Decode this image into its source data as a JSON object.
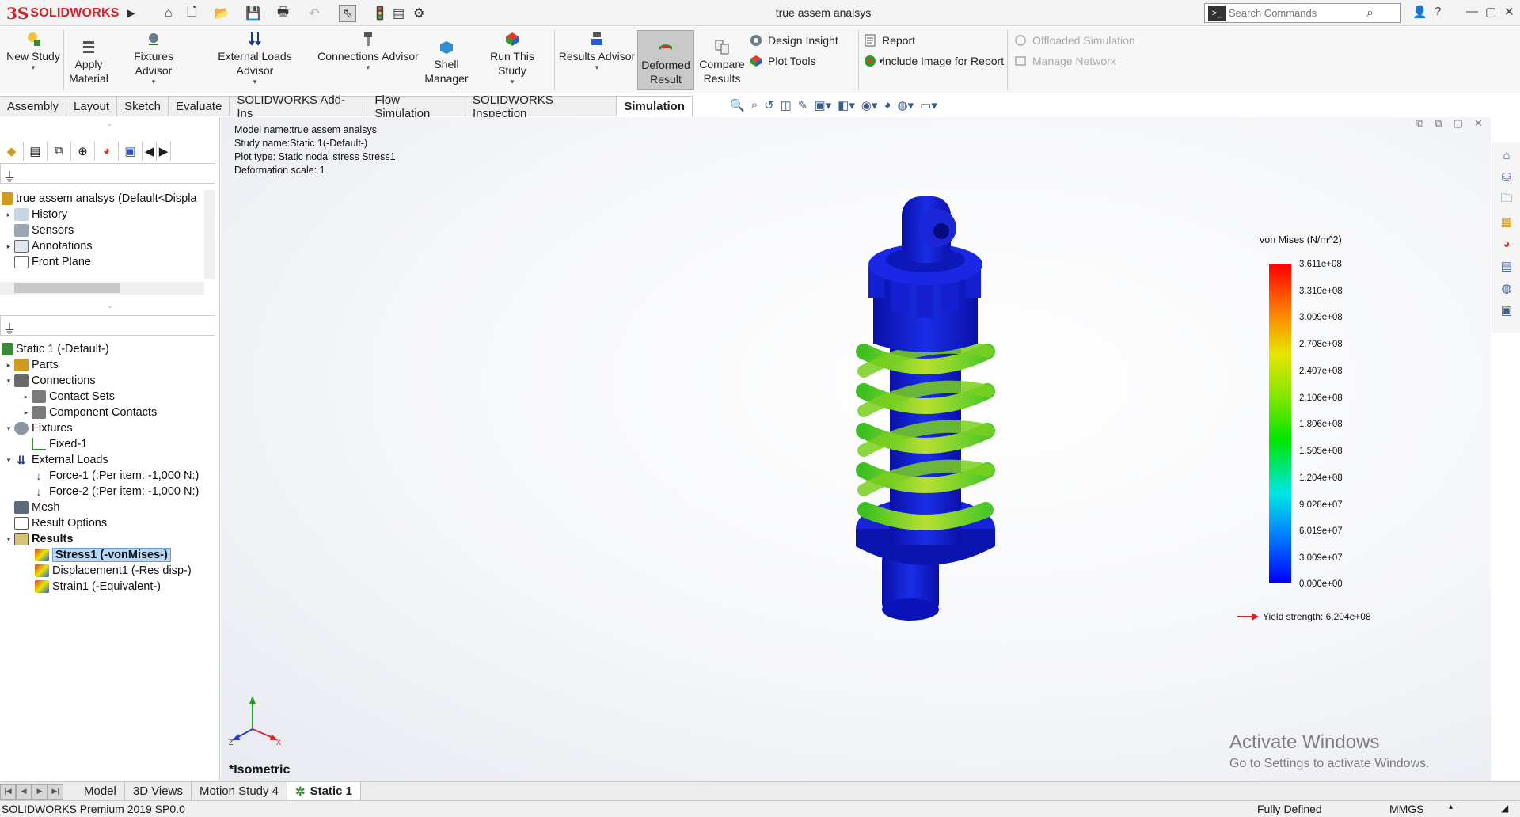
{
  "titlebar": {
    "logo_text": "SOLIDWORKS",
    "logo_mark": "3S",
    "window_title": "true assem analsys",
    "search_placeholder": "Search Commands"
  },
  "ribbon": {
    "buttons": [
      {
        "label": "New Study",
        "icon": "new-study-icon"
      },
      {
        "label": "Apply\nMaterial",
        "icon": "apply-material-icon"
      },
      {
        "label": "Fixtures Advisor",
        "icon": "fixtures-advisor-icon"
      },
      {
        "label": "External Loads Advisor",
        "icon": "external-loads-icon"
      },
      {
        "label": "Connections Advisor",
        "icon": "connections-advisor-icon"
      },
      {
        "label": "Shell\nManager",
        "icon": "shell-manager-icon"
      },
      {
        "label": "Run This Study",
        "icon": "run-study-icon"
      },
      {
        "label": "Results Advisor",
        "icon": "results-advisor-icon"
      },
      {
        "label": "Deformed\nResult",
        "icon": "deformed-result-icon",
        "active": true
      },
      {
        "label": "Compare\nResults",
        "icon": "compare-results-icon"
      }
    ],
    "small": {
      "design_insight": "Design Insight",
      "plot_tools": "Plot Tools",
      "report": "Report",
      "include_image": "Include Image for Report",
      "offloaded_simulation": "Offloaded Simulation",
      "manage_network": "Manage Network"
    }
  },
  "command_tabs": [
    "Assembly",
    "Layout",
    "Sketch",
    "Evaluate",
    "SOLIDWORKS Add-Ins",
    "Flow Simulation",
    "SOLIDWORKS Inspection",
    "Simulation"
  ],
  "active_command_tab": "Simulation",
  "feature_tree": {
    "root": "true assem analsys  (Default<Displa",
    "items": [
      "History",
      "Sensors",
      "Annotations",
      "Front Plane"
    ]
  },
  "study_tree": {
    "root": "Static 1 (-Default-)",
    "parts": "Parts",
    "connections": "Connections",
    "contact_sets": "Contact Sets",
    "component_contacts": "Component Contacts",
    "fixtures": "Fixtures",
    "fixed1": "Fixed-1",
    "external_loads": "External Loads",
    "force1": "Force-1 (:Per item: -1,000 N:)",
    "force2": "Force-2 (:Per item: -1,000 N:)",
    "mesh": "Mesh",
    "result_options": "Result Options",
    "results": "Results",
    "stress1": "Stress1 (-vonMises-)",
    "displacement1": "Displacement1 (-Res disp-)",
    "strain1": "Strain1 (-Equivalent-)"
  },
  "viewport": {
    "model_name": "Model name:true assem analsys",
    "study_name": "Study name:Static 1(-Default-)",
    "plot_type": "Plot type: Static nodal stress Stress1",
    "deformation_scale": "Deformation scale: 1",
    "view_name": "*Isometric",
    "activate_title": "Activate Windows",
    "activate_sub": "Go to Settings to activate Windows."
  },
  "legend": {
    "title": "von Mises (N/m^2)",
    "values": [
      "3.611e+08",
      "3.310e+08",
      "3.009e+08",
      "2.708e+08",
      "2.407e+08",
      "2.106e+08",
      "1.806e+08",
      "1.505e+08",
      "1.204e+08",
      "9.028e+07",
      "6.019e+07",
      "3.009e+07",
      "0.000e+00"
    ],
    "yield": "Yield strength: 6.204e+08",
    "yield_color": "#e31b1b"
  },
  "bottom_tabs": [
    "Model",
    "3D Views",
    "Motion Study 4",
    "Static 1"
  ],
  "active_bottom_tab": "Static 1",
  "status": {
    "product": "SOLIDWORKS Premium 2019 SP0.0",
    "state": "Fully Defined",
    "units": "MMGS"
  },
  "colors": {
    "accent_red": "#d2232a",
    "mesh_blue": "#0a1fd0",
    "spring_green": "#7ad01f"
  }
}
